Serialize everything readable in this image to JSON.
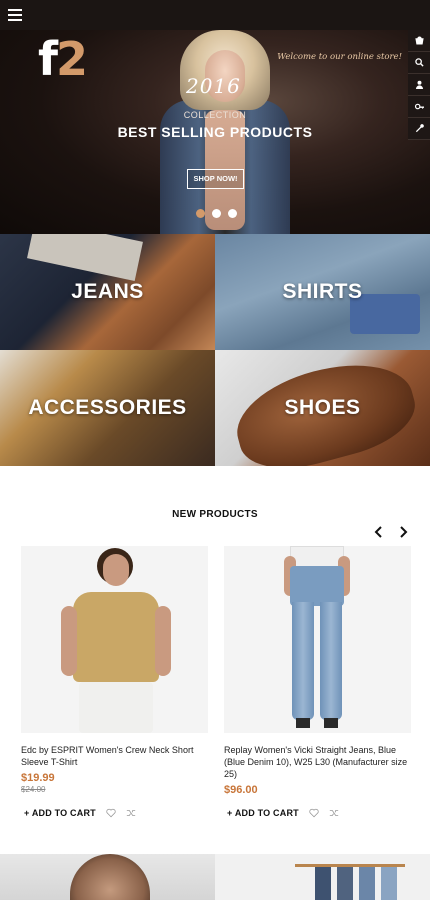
{
  "hero": {
    "logo_f": "f",
    "logo_2": "2",
    "welcome": "Welcome to our online store!",
    "year": "2016",
    "collection": "COLLECTION",
    "headline": "BEST SELLING PRODUCTS",
    "cta": "SHOP NOW!",
    "slides": 3,
    "active_slide": 1
  },
  "side_tools": [
    "cart-icon",
    "search-icon",
    "user-icon",
    "key-icon",
    "wrench-icon"
  ],
  "categories": [
    {
      "label": "JEANS"
    },
    {
      "label": "SHIRTS"
    },
    {
      "label": "ACCESSORIES"
    },
    {
      "label": "SHOES"
    }
  ],
  "new_products": {
    "title": "NEW PRODUCTS",
    "prev": "‹",
    "next": "›",
    "items": [
      {
        "name": "Edc by ESPRIT Women's Crew Neck Short Sleeve T-Shirt",
        "price": "$19.99",
        "old_price": "$24.00",
        "add_to_cart": "+ ADD TO CART"
      },
      {
        "name": "Replay Women's Vicki Straight Jeans, Blue (Blue Denim 10), W25 L30 (Manufacturer size 25)",
        "price": "$96.00",
        "old_price": "",
        "add_to_cart": "+ ADD TO CART"
      }
    ]
  },
  "colors": {
    "accent": "#c8763a",
    "topbar": "#1b1513",
    "logo_accent": "#d39a6a"
  }
}
